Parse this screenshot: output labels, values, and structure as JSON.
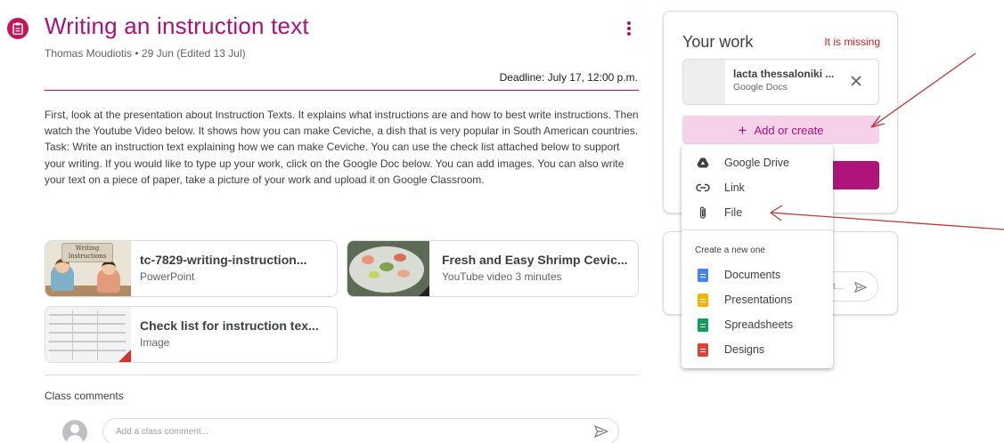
{
  "assignment": {
    "title": "Writing an instruction text",
    "meta": "Thomas Moudiotis • 29 Jun  (Edited 13 Jul)",
    "deadline": "Deadline: July 17, 12:00 p.m.",
    "description": "First, look at the presentation about Instruction Texts. It explains what instructions are and how to best write instructions. Then watch the Youtube Video below. It shows how you can make Ceviche, a dish that is very popular in South American countries. Task: Write an instruction text explaining how we can make Ceviche. You can use the check list attached below to support your writing. If you would like to type up your work, click on the Google Doc below. You can add images. You can also write your text on a piece of paper, take a picture of your work and upload it on Google Classroom."
  },
  "attachments": [
    {
      "title": "tc-7829-writing-instruction...",
      "subtitle": "PowerPoint",
      "thumb_text": "Writing Instructions"
    },
    {
      "title": "Fresh and Easy Shrimp Cevic...",
      "subtitle": "YouTube video 3 minutes"
    },
    {
      "title": "Check list for instruction tex...",
      "subtitle": "Image"
    }
  ],
  "comments": {
    "label": "Class comments",
    "placeholder": "Add a class comment..."
  },
  "your_work": {
    "title": "Your work",
    "status": "It is missing",
    "file": {
      "name": "lacta thessaloniki ...",
      "type": "Google Docs"
    },
    "add_label": "Add or create"
  },
  "private_comment": {
    "partial_placeholder": "t..."
  },
  "menu": {
    "items": [
      {
        "label": "Google Drive",
        "icon": "google-drive-icon"
      },
      {
        "label": "Link",
        "icon": "link-icon"
      },
      {
        "label": "File",
        "icon": "paperclip-icon"
      }
    ],
    "create_heading": "Create a new one",
    "create_items": [
      {
        "label": "Documents",
        "icon": "docs-icon",
        "color": "#4285f4"
      },
      {
        "label": "Presentations",
        "icon": "slides-icon",
        "color": "#f4b400"
      },
      {
        "label": "Spreadsheets",
        "icon": "sheets-icon",
        "color": "#0f9d58"
      },
      {
        "label": "Designs",
        "icon": "drawings-icon",
        "color": "#db4437"
      }
    ]
  },
  "colors": {
    "accent": "#a3137a",
    "missing": "#c5221f",
    "add_button_bg": "#f5d2ea",
    "annotation_arrow": "#b83a3a"
  }
}
